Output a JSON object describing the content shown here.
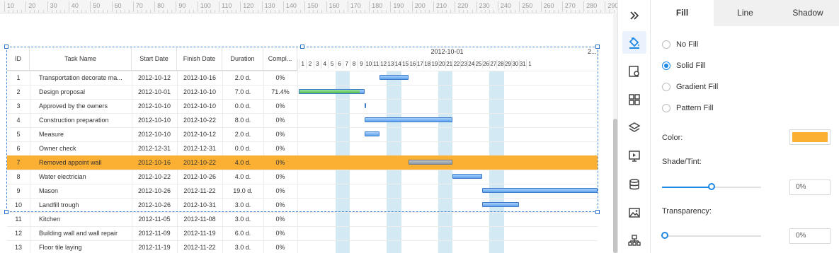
{
  "ruler": {
    "ticks": [
      "10",
      "20",
      "30",
      "40",
      "50",
      "60",
      "70",
      "80",
      "90",
      "100",
      "110",
      "120",
      "130",
      "140",
      "150",
      "160",
      "170",
      "180",
      "190",
      "200",
      "210",
      "220",
      "230",
      "240",
      "250",
      "260",
      "270",
      "280",
      "290"
    ]
  },
  "gantt": {
    "headers": {
      "id": "ID",
      "task_name": "Task Name",
      "start_date": "Start Date",
      "finish_date": "Finish Date",
      "duration": "Duration",
      "complete": "Compl..."
    },
    "timeline": {
      "month_label": "2012-10-01",
      "month_label_2": "2...",
      "days": [
        "1",
        "2",
        "3",
        "4",
        "5",
        "6",
        "7",
        "8",
        "9",
        "10",
        "11",
        "12",
        "13",
        "14",
        "15",
        "16",
        "17",
        "18",
        "19",
        "20",
        "21",
        "22",
        "23",
        "24",
        "25",
        "26",
        "27",
        "28",
        "29",
        "30",
        "31",
        "1"
      ]
    },
    "rows": [
      {
        "id": "1",
        "name": "Transportation decorate ma...",
        "start": "2012-10-12",
        "finish": "2012-10-16",
        "duration": "2.0 d.",
        "complete": "0%"
      },
      {
        "id": "2",
        "name": "Design proposal",
        "start": "2012-10-01",
        "finish": "2012-10-10",
        "duration": "7.0 d.",
        "complete": "71.4%"
      },
      {
        "id": "3",
        "name": "Approved by the owners",
        "start": "2012-10-10",
        "finish": "2012-10-10",
        "duration": "0.0 d.",
        "complete": "0%"
      },
      {
        "id": "4",
        "name": "Construction preparation",
        "start": "2012-10-10",
        "finish": "2012-10-22",
        "duration": "8.0 d.",
        "complete": "0%"
      },
      {
        "id": "5",
        "name": "Measure",
        "start": "2012-10-10",
        "finish": "2012-10-12",
        "duration": "2.0 d.",
        "complete": "0%"
      },
      {
        "id": "6",
        "name": "Owner check",
        "start": "2012-12-31",
        "finish": "2012-12-31",
        "duration": "0.0 d.",
        "complete": "0%"
      },
      {
        "id": "7",
        "name": "Removed appoint wall",
        "start": "2012-10-16",
        "finish": "2012-10-22",
        "duration": "4.0 d.",
        "complete": "0%",
        "highlight": true
      },
      {
        "id": "8",
        "name": "Water electrician",
        "start": "2012-10-22",
        "finish": "2012-10-26",
        "duration": "4.0 d.",
        "complete": "0%"
      },
      {
        "id": "9",
        "name": "Mason",
        "start": "2012-10-26",
        "finish": "2012-11-22",
        "duration": "19.0 d.",
        "complete": "0%"
      },
      {
        "id": "10",
        "name": "Landfill trough",
        "start": "2012-10-26",
        "finish": "2012-10-31",
        "duration": "3.0 d.",
        "complete": "0%"
      },
      {
        "id": "11",
        "name": "Kitchen",
        "start": "2012-11-05",
        "finish": "2012-11-08",
        "duration": "3.0 d.",
        "complete": "0%"
      },
      {
        "id": "12",
        "name": "Building wall and wall repair",
        "start": "2012-11-09",
        "finish": "2012-11-19",
        "duration": "6.0 d.",
        "complete": "0%"
      },
      {
        "id": "13",
        "name": "Floor tile laying",
        "start": "2012-11-19",
        "finish": "2012-11-22",
        "duration": "3.0 d.",
        "complete": "0%"
      }
    ]
  },
  "iconbar": {
    "collapse_icon": "double-chevron-right-icon",
    "icons": [
      "fill-bucket-icon",
      "page-settings-icon",
      "grid-icon",
      "layers-icon",
      "presentation-icon",
      "database-icon",
      "image-icon",
      "org-chart-icon"
    ]
  },
  "panel": {
    "tabs": [
      "Fill",
      "Line",
      "Shadow"
    ],
    "fill_options": [
      "No Fill",
      "Solid Fill",
      "Gradient Fill",
      "Pattern Fill"
    ],
    "selected_fill": "Solid Fill",
    "color_label": "Color:",
    "color_value": "#fbb034",
    "shade_label": "Shade/Tint:",
    "shade_value": "0%",
    "shade_level": 0.5,
    "transparency_label": "Transparency:",
    "transparency_value": "0%",
    "transparency_level": 0
  },
  "colors": {
    "accent": "#1e88e5",
    "highlight_row": "#fbb034",
    "weekend": "#d3e9f4",
    "bar": "#5ea2ec",
    "progress": "#5cc85c"
  }
}
